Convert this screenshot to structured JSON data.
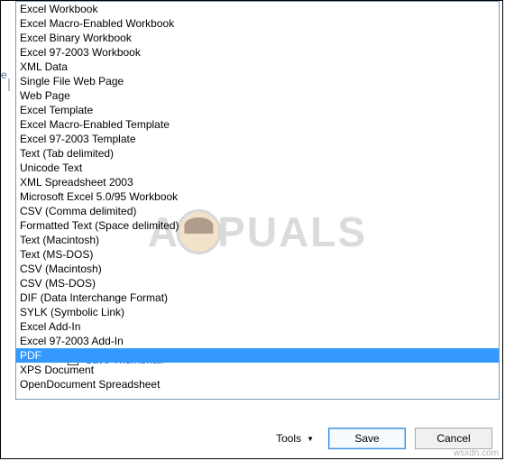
{
  "left_marker": "e",
  "format_list": {
    "selected_index": 25,
    "items": [
      "Excel Workbook",
      "Excel Macro-Enabled Workbook",
      "Excel Binary Workbook",
      "Excel 97-2003 Workbook",
      "XML Data",
      "Single File Web Page",
      "Web Page",
      "Excel Template",
      "Excel Macro-Enabled Template",
      "Excel 97-2003 Template",
      "Text (Tab delimited)",
      "Unicode Text",
      "XML Spreadsheet 2003",
      "Microsoft Excel 5.0/95 Workbook",
      "CSV (Comma delimited)",
      "Formatted Text (Space delimited)",
      "Text (Macintosh)",
      "Text (MS-DOS)",
      "CSV (Macintosh)",
      "CSV (MS-DOS)",
      "DIF (Data Interchange Format)",
      "SYLK (Symbolic Link)",
      "Excel Add-In",
      "Excel 97-2003 Add-In",
      "XPS Document",
      "PDF",
      "XPS Document",
      "OpenDocument Spreadsheet"
    ]
  },
  "save_thumbnail": {
    "label": "Save Thumbnail",
    "checked": false
  },
  "buttons": {
    "tools": "Tools",
    "save": "Save",
    "cancel": "Cancel"
  },
  "watermark": {
    "left": "A",
    "right": "PUALS"
  },
  "footer_mark": "wsxdn.com"
}
